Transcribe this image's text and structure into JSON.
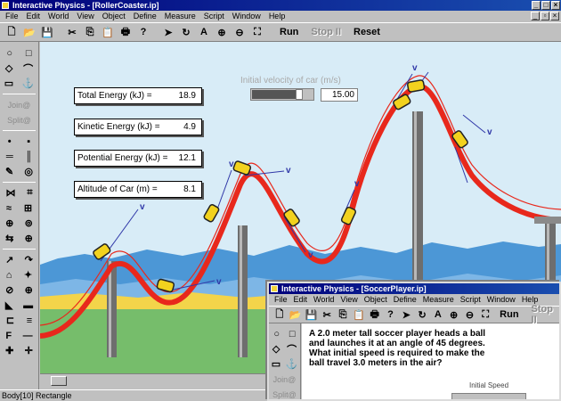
{
  "main_window": {
    "title": "Interactive Physics - [RollerCoaster.ip]",
    "menu": [
      "File",
      "Edit",
      "World",
      "View",
      "Object",
      "Define",
      "Measure",
      "Script",
      "Window",
      "Help"
    ],
    "toolbar": {
      "run": "Run",
      "stop": "Stop II",
      "reset": "Reset"
    }
  },
  "meters": [
    {
      "label": "Total Energy (kJ) =",
      "value": "18.9"
    },
    {
      "label": "Kinetic Energy (kJ) =",
      "value": "4.9"
    },
    {
      "label": "Potential Energy (kJ) =",
      "value": "12.1"
    },
    {
      "label": "Altitude of Car (m) =",
      "value": "8.1"
    }
  ],
  "slider": {
    "label": "Initial velocity of car (m/s)",
    "value": "15.00",
    "level": 0.8
  },
  "vector_label": "v",
  "palette": {
    "disabled_1": "Join@",
    "disabled_2": "Split@"
  },
  "status": {
    "text": "Body[10] Rectangle"
  },
  "second_window": {
    "title": "Interactive Physics - [SoccerPlayer.ip]",
    "menu": [
      "File",
      "Edit",
      "World",
      "View",
      "Object",
      "Define",
      "Measure",
      "Script",
      "Window",
      "Help"
    ],
    "toolbar": {
      "run": "Run",
      "stop": "Stop II"
    },
    "problem_lines": [
      "A 2.0 meter tall soccer player heads a ball",
      "and launches it at an angle of 45 degrees.",
      "What initial speed is required to make the",
      "ball travel 3.0 meters in the air?"
    ],
    "slider_label": "Initial Speed"
  },
  "colors": {
    "track": "#e8281c",
    "sky": "#d8ecf7",
    "hills": "#4c97d6",
    "grass": "#5cae5a",
    "sand": "#f3d44a",
    "title_bar": "#00007b"
  }
}
